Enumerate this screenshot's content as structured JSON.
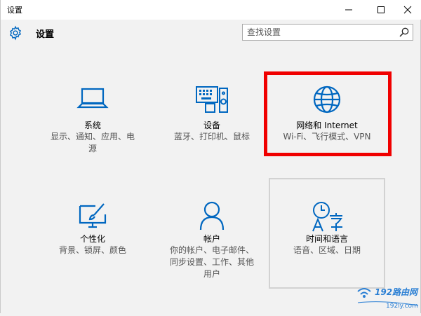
{
  "window": {
    "title": "设置",
    "controls": [
      "minimize",
      "maximize",
      "close"
    ]
  },
  "header": {
    "title": "设置",
    "search_placeholder": "查找设置"
  },
  "tiles": [
    {
      "name": "系统",
      "desc_lines": [
        "显示、通知、应用、电",
        "源"
      ],
      "icon": "laptop-icon"
    },
    {
      "name": "设备",
      "desc_lines": [
        "蓝牙、打印机、鼠标"
      ],
      "icon": "devices-icon"
    },
    {
      "name": "网络和 Internet",
      "desc_lines": [
        "Wi-Fi、飞行模式、VPN"
      ],
      "icon": "globe-icon"
    },
    {
      "name": "个性化",
      "desc_lines": [
        "背景、锁屏、颜色"
      ],
      "icon": "paintbrush-icon"
    },
    {
      "name": "帐户",
      "desc_lines": [
        "你的帐户、电子邮件、",
        "同步设置、工作、其他",
        "用户"
      ],
      "icon": "person-icon"
    },
    {
      "name": "时间和语言",
      "desc_lines": [
        "语音、区域、日期"
      ],
      "icon": "clock-language-icon"
    }
  ],
  "colors": {
    "accent": "#0067c0",
    "highlight_border": "#f00000",
    "background": "#f2f2f2"
  },
  "watermark": {
    "brand": "192路由网",
    "url": "192ly.com"
  }
}
